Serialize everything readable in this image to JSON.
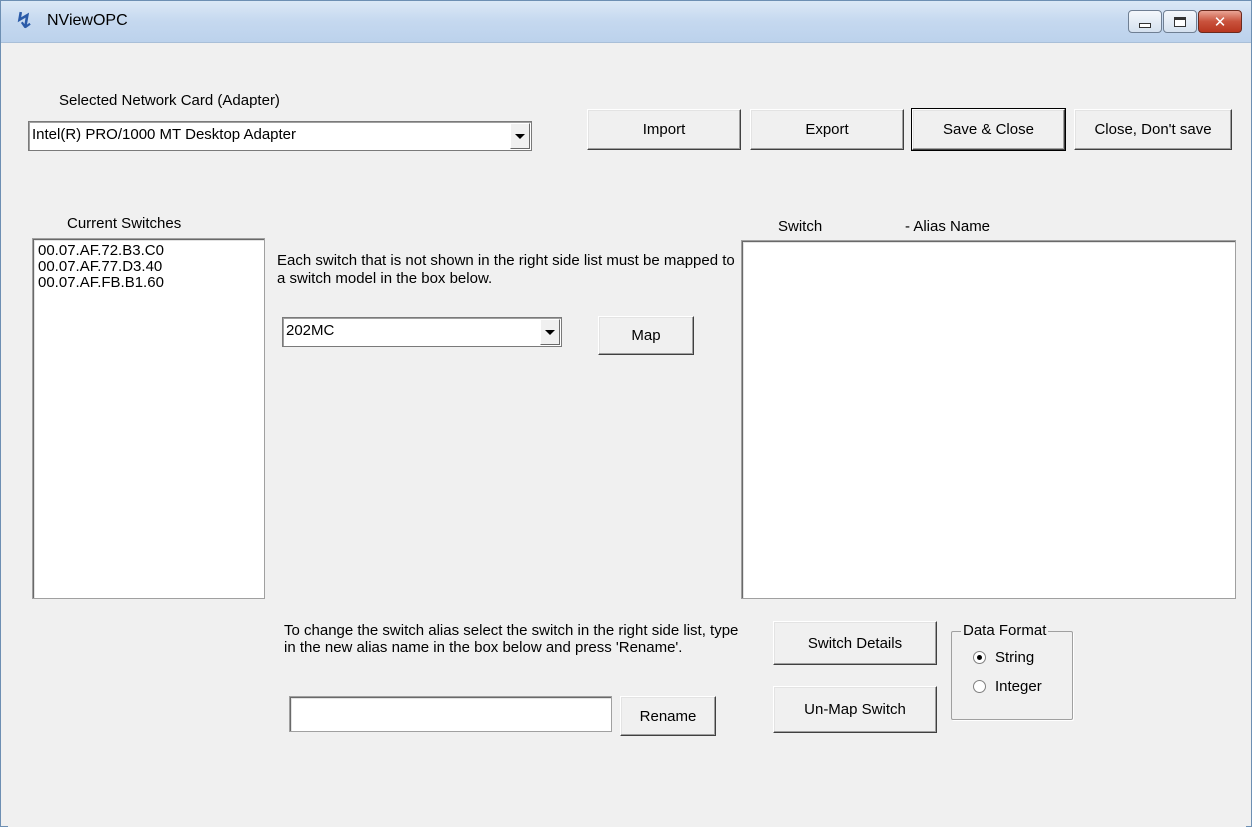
{
  "window": {
    "title": "NViewOPC"
  },
  "adapter": {
    "label": "Selected Network Card (Adapter)",
    "selected": "Intel(R) PRO/1000 MT Desktop Adapter"
  },
  "toolbar": {
    "import_label": "Import",
    "export_label": "Export",
    "save_close_label": "Save & Close",
    "close_nosave_label": "Close, Don't save"
  },
  "current_switches": {
    "label": "Current Switches",
    "items": [
      "00.07.AF.72.B3.C0",
      "00.07.AF.77.D3.40",
      "00.07.AF.FB.B1.60"
    ]
  },
  "mapping": {
    "instructions": "Each switch that is not shown in the right side list must be mapped to a switch model in the box below.",
    "model_selected": "202MC",
    "map_label": "Map"
  },
  "mapped_list": {
    "header_switch": "Switch",
    "header_alias": "- Alias Name",
    "items": []
  },
  "rename": {
    "instructions": "To change the switch alias select the switch in the right side list, type in the new alias name in the box below and press 'Rename'.",
    "value": "",
    "button_label": "Rename"
  },
  "switch_actions": {
    "details_label": "Switch Details",
    "unmap_label": "Un-Map Switch"
  },
  "data_format": {
    "label": "Data Format",
    "options": [
      "String",
      "Integer"
    ],
    "selected": "String"
  }
}
